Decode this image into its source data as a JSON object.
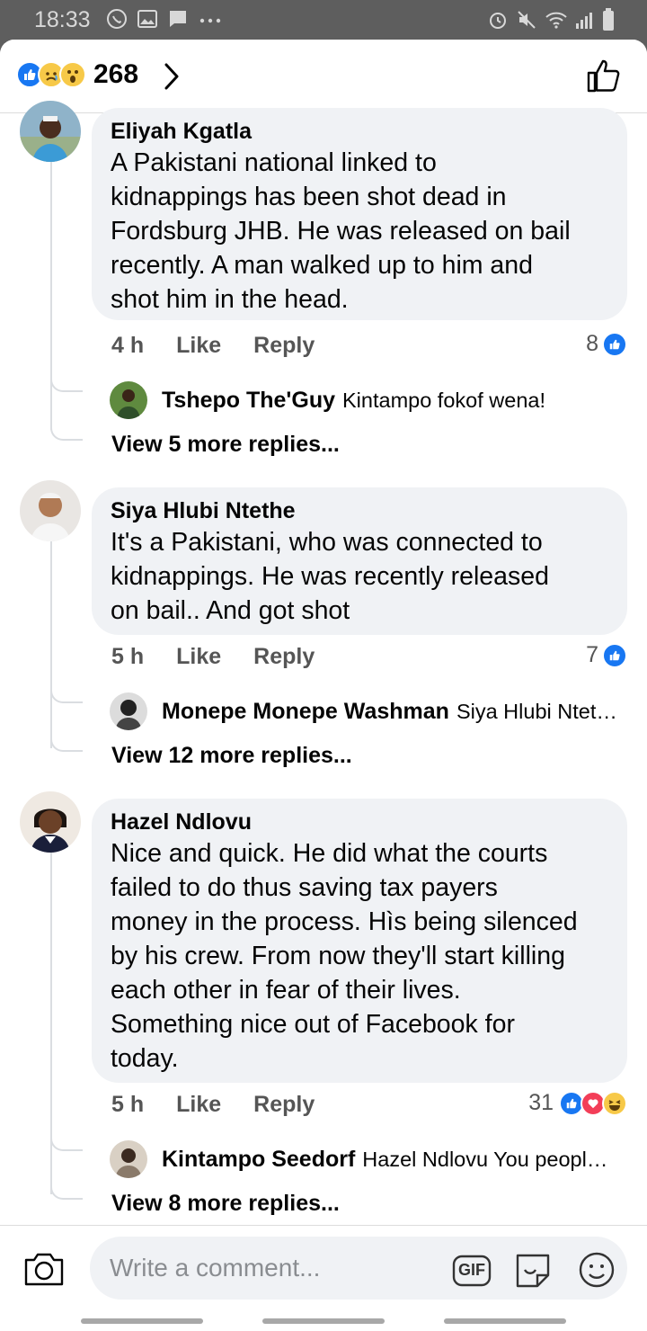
{
  "status_bar": {
    "time": "18:33"
  },
  "header": {
    "reaction_count": "268"
  },
  "comments": [
    {
      "author": "Eliyah Kgatla",
      "lines": [
        "A Pakistani national linked to",
        "kidnappings has been shot dead in",
        "Fordsburg JHB. He was released on bail",
        "recently. A man walked up to him and",
        "shot him in the head."
      ],
      "time": "4 h",
      "like": "Like",
      "reply": "Reply",
      "reactions": "8",
      "reply_preview": {
        "author": "Tshepo The'Guy",
        "text": "Kintampo fokof wena!"
      },
      "view_more": "View 5 more replies..."
    },
    {
      "author": "Siya Hlubi Ntethe",
      "lines": [
        "It's a Pakistani, who was connected to",
        "kidnappings. He was recently released",
        "on bail.. And got shot"
      ],
      "time": "5 h",
      "like": "Like",
      "reply": "Reply",
      "reactions": "7",
      "reply_preview": {
        "author": "Monepe Monepe Washman",
        "text": "Siya Hlubi Ntet…"
      },
      "view_more": "View 12 more replies..."
    },
    {
      "author": "Hazel Ndlovu",
      "lines": [
        "Nice and quick. He did what the courts",
        "failed to do thus saving tax payers",
        "money in the process. Hìs being silenced",
        "by his crew. From now they'll start killing",
        "each other in fear of their lives.",
        "Something nice out of Facebook for",
        "today."
      ],
      "time": "5 h",
      "like": "Like",
      "reply": "Reply",
      "reactions": "31",
      "reply_preview": {
        "author": "Kintampo Seedorf",
        "text": "Hazel Ndlovu You peopl…"
      },
      "view_more": "View 8 more replies..."
    }
  ],
  "composer": {
    "placeholder": "Write a comment...",
    "gif_label": "GIF"
  },
  "colors": {
    "facebook_blue": "#1877f2",
    "bubble_bg": "#f0f2f5",
    "love_red": "#f33e58",
    "haha_yellow": "#f7c948"
  }
}
